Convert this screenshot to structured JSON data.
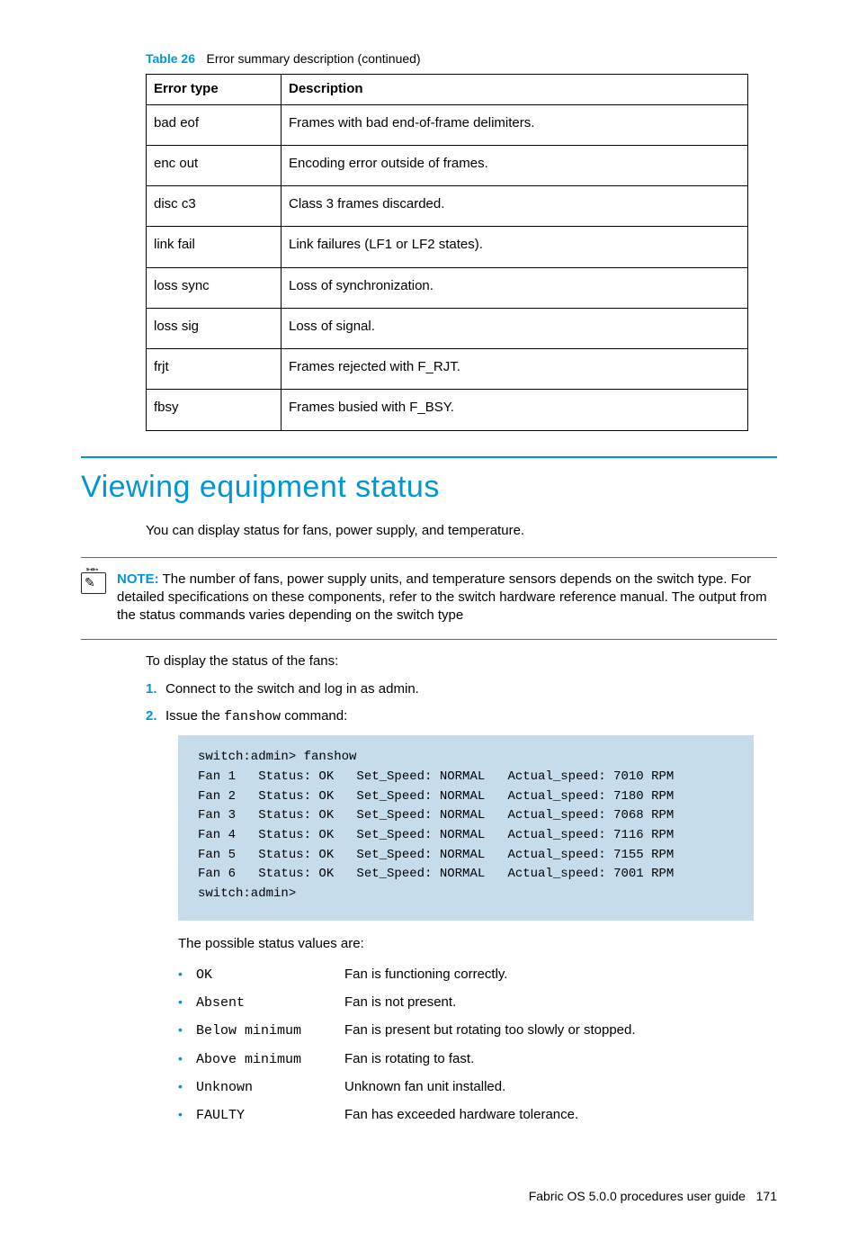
{
  "table": {
    "caption_prefix": "Table 26",
    "caption_text": "Error summary description (continued)",
    "headers": {
      "c0": "Error type",
      "c1": "Description"
    },
    "rows": [
      {
        "c0": "bad eof",
        "c1": "Frames with bad end-of-frame delimiters."
      },
      {
        "c0": "enc out",
        "c1": "Encoding error outside of frames."
      },
      {
        "c0": "disc c3",
        "c1": "Class 3 frames discarded."
      },
      {
        "c0": "link fail",
        "c1": "Link failures (LF1 or LF2 states)."
      },
      {
        "c0": "loss sync",
        "c1": "Loss of synchronization."
      },
      {
        "c0": "loss sig",
        "c1": "Loss of signal."
      },
      {
        "c0": "frjt",
        "c1": "Frames rejected with F_RJT."
      },
      {
        "c0": "fbsy",
        "c1": "Frames busied with F_BSY."
      }
    ]
  },
  "section": {
    "title": "Viewing equipment status",
    "intro": "You can display status for fans, power supply, and temperature."
  },
  "note": {
    "label": "NOTE:",
    "body": "The number of fans, power supply units, and temperature sensors depends on the switch type. For detailed specifications on these components, refer to the switch hardware reference manual. The output from the status commands varies depending on the switch type"
  },
  "steps": {
    "intro": "To display the status of the fans:",
    "items": [
      {
        "n": "1.",
        "text_before": "Connect to the switch and log in as admin.",
        "code": "",
        "text_after": ""
      },
      {
        "n": "2.",
        "text_before": "Issue the ",
        "code": "fanshow",
        "text_after": " command:"
      }
    ]
  },
  "code_block": "switch:admin> fanshow\nFan 1   Status: OK   Set_Speed: NORMAL   Actual_speed: 7010 RPM\nFan 2   Status: OK   Set_Speed: NORMAL   Actual_speed: 7180 RPM\nFan 3   Status: OK   Set_Speed: NORMAL   Actual_speed: 7068 RPM\nFan 4   Status: OK   Set_Speed: NORMAL   Actual_speed: 7116 RPM\nFan 5   Status: OK   Set_Speed: NORMAL   Actual_speed: 7155 RPM\nFan 6   Status: OK   Set_Speed: NORMAL   Actual_speed: 7001 RPM\nswitch:admin>",
  "status": {
    "intro": "The possible status values are:",
    "items": [
      {
        "code": "OK",
        "desc": "Fan is functioning correctly."
      },
      {
        "code": "Absent",
        "desc": "Fan is not present."
      },
      {
        "code": "Below minimum",
        "desc": "Fan is present but rotating too slowly or stopped."
      },
      {
        "code": "Above minimum",
        "desc": "Fan is rotating to fast."
      },
      {
        "code": "Unknown",
        "desc": "Unknown fan unit installed."
      },
      {
        "code": "FAULTY",
        "desc": "Fan has exceeded hardware tolerance."
      }
    ]
  },
  "footer": {
    "text": "Fabric OS 5.0.0 procedures user guide",
    "page": "171"
  }
}
